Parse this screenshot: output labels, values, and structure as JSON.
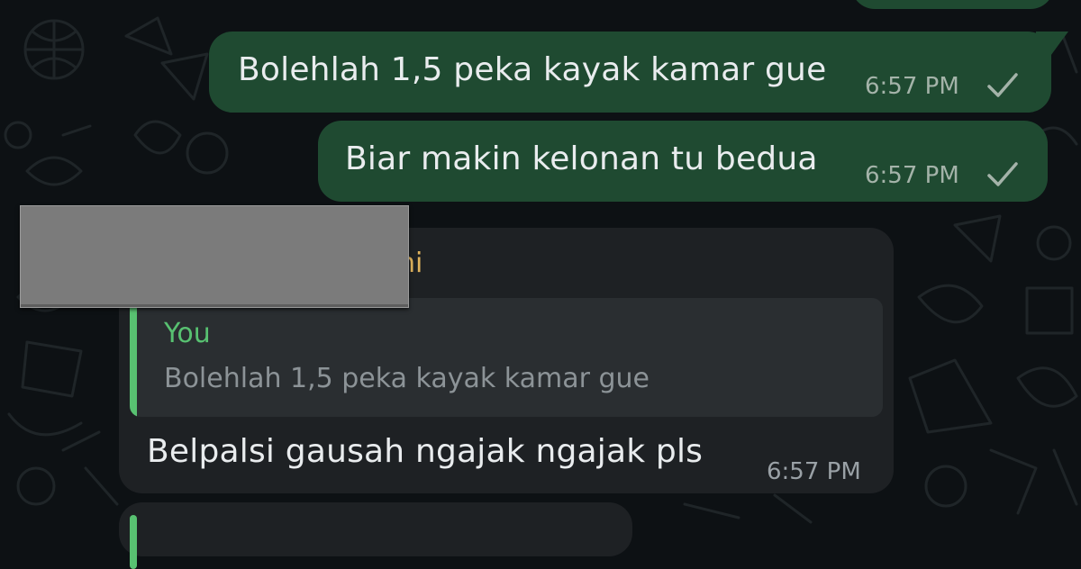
{
  "colors": {
    "background": "#0d1114",
    "outgoing_bubble": "#1f4a31",
    "incoming_bubble": "#1e2124",
    "quote_accent": "#58c171",
    "sender_name": "#e0b35d",
    "read_tick": "#a4b3a9",
    "redaction": "#7b7b7b"
  },
  "messages": [
    {
      "direction": "outgoing",
      "text": "Bolehlah 1,5 peka kayak kamar gue",
      "time": "6:57 PM",
      "status_icon": "single-check-icon"
    },
    {
      "direction": "outgoing",
      "text": "Biar makin kelonan tu bedua",
      "time": "6:57 PM",
      "status_icon": "single-check-icon"
    },
    {
      "direction": "incoming",
      "sender_visible_suffix": "ni",
      "sender_redacted": true,
      "quoted": {
        "author": "You",
        "text": "Bolehlah 1,5 peka kayak kamar gue"
      },
      "text": "Belpalsi gausah ngajak ngajak pls",
      "time": "6:57 PM"
    }
  ]
}
